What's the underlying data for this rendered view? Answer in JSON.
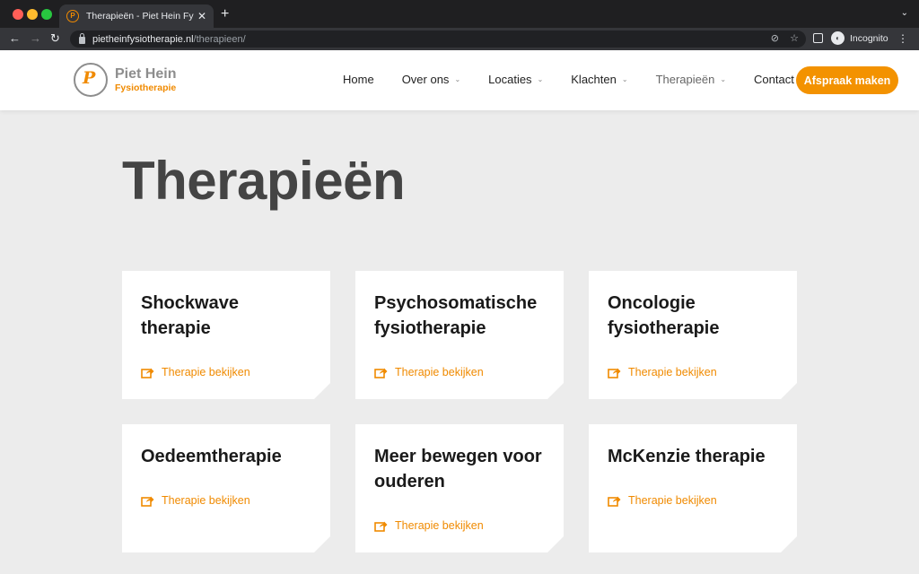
{
  "browser": {
    "tab_title": "Therapieën - Piet Hein Fysioth",
    "url_host": "pietheinfysiotherapie.nl",
    "url_path": "/therapieen/",
    "profile_label": "Incognito"
  },
  "site": {
    "logo_name": "Piet Hein",
    "logo_sub": "Fysiotherapie",
    "nav": [
      {
        "label": "Home"
      },
      {
        "label": "Over ons"
      },
      {
        "label": "Locaties"
      },
      {
        "label": "Klachten"
      },
      {
        "label": "Therapieën"
      },
      {
        "label": "Contact"
      }
    ],
    "cta_label": "Afspraak maken",
    "accent_color": "#f39200"
  },
  "main": {
    "title": "Therapieën",
    "link_label": "Therapie bekijken",
    "cards": [
      {
        "title": "Shockwave therapie"
      },
      {
        "title": "Psychosomatische fysiotherapie"
      },
      {
        "title": "Oncologie fysiotherapie"
      },
      {
        "title": "Oedeemtherapie"
      },
      {
        "title": "Meer bewegen voor ouderen"
      },
      {
        "title": "McKenzie therapie"
      }
    ]
  }
}
